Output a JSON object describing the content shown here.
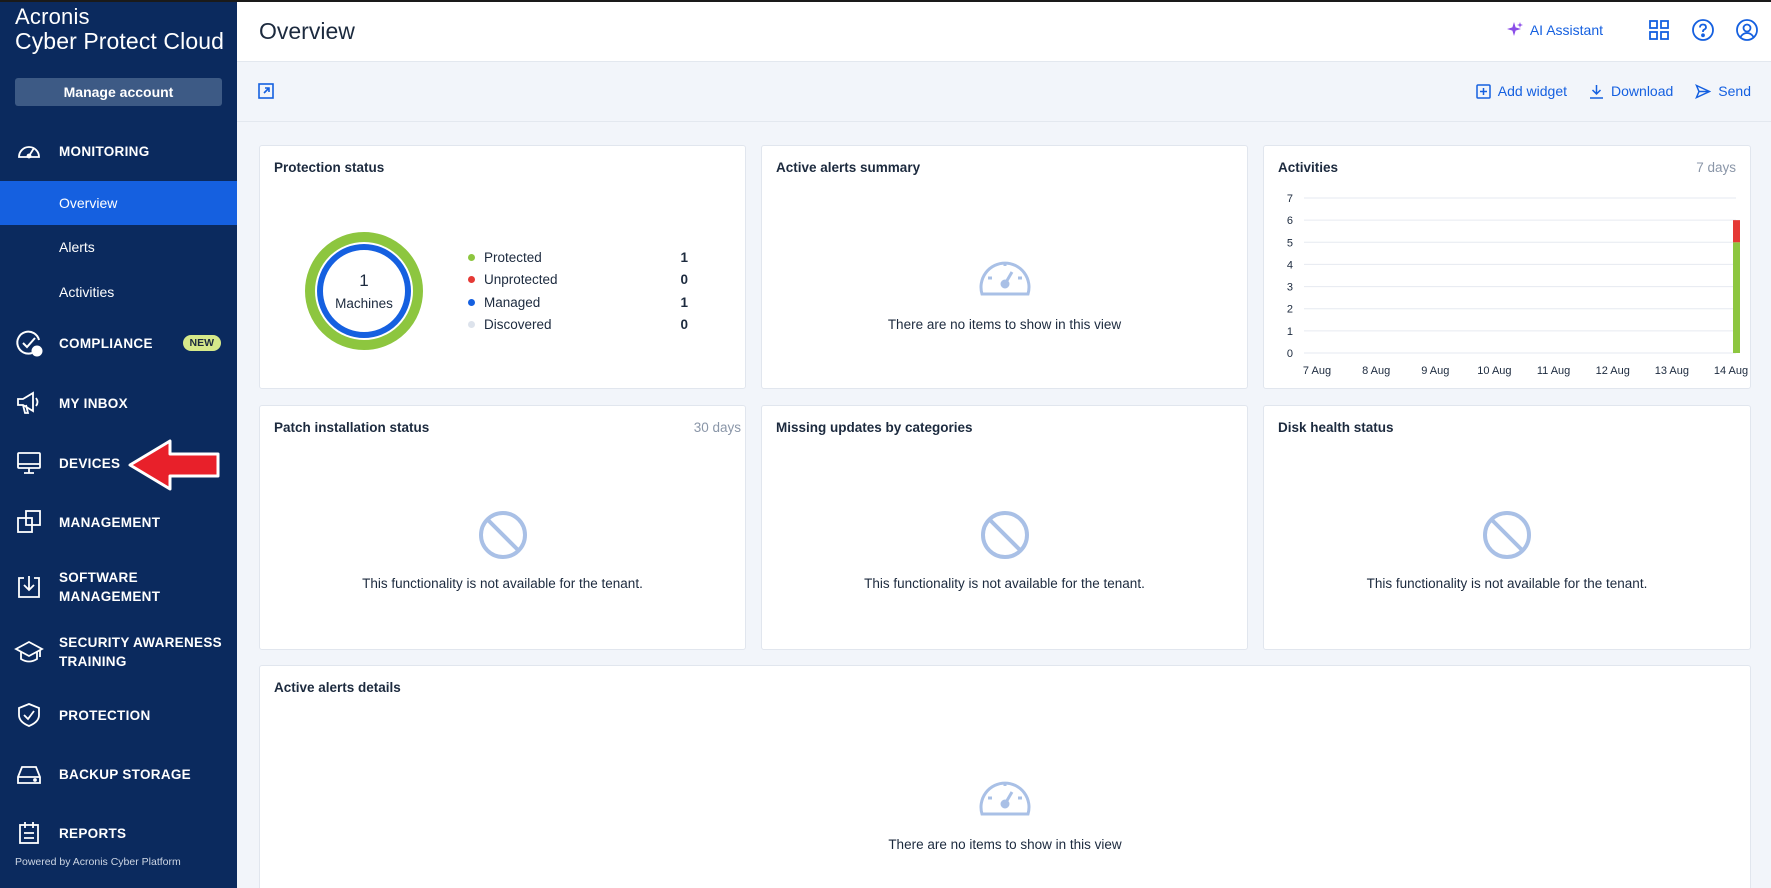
{
  "brand": {
    "line1": "Acronis",
    "line2": "Cyber Protect Cloud"
  },
  "sidebar": {
    "manage_account": "Manage account",
    "monitoring": "MONITORING",
    "sub_items": [
      "Overview",
      "Alerts",
      "Activities"
    ],
    "compliance": "COMPLIANCE",
    "new_badge": "NEW",
    "my_inbox": "MY INBOX",
    "devices": "DEVICES",
    "management": "MANAGEMENT",
    "software_management": [
      "SOFTWARE",
      "MANAGEMENT"
    ],
    "security_awareness": [
      "SECURITY AWARENESS",
      "TRAINING"
    ],
    "protection": "PROTECTION",
    "backup_storage": "BACKUP STORAGE",
    "reports": "REPORTS",
    "powered_by": "Powered by Acronis Cyber Platform"
  },
  "header": {
    "title": "Overview",
    "ai_assistant": "AI Assistant"
  },
  "toolbar": {
    "add_widget": "Add widget",
    "download": "Download",
    "send": "Send"
  },
  "widgets": {
    "protection_status": {
      "title": "Protection status",
      "center_value": "1",
      "center_label": "Machines",
      "legend": [
        {
          "name": "Protected",
          "value": "1",
          "color": "#8dc63f"
        },
        {
          "name": "Unprotected",
          "value": "0",
          "color": "#e53935"
        },
        {
          "name": "Managed",
          "value": "1",
          "color": "#1560e0"
        },
        {
          "name": "Discovered",
          "value": "0",
          "color": "#dde3ec"
        }
      ]
    },
    "active_alerts_summary": {
      "title": "Active alerts summary",
      "empty": "There are no items to show in this view"
    },
    "activities": {
      "title": "Activities",
      "range": "7 days"
    },
    "patch_installation": {
      "title": "Patch installation status",
      "range": "30 days",
      "empty": "This functionality is not available for the tenant."
    },
    "missing_updates": {
      "title": "Missing updates by categories",
      "empty": "This functionality is not available for the tenant."
    },
    "disk_health": {
      "title": "Disk health status",
      "empty": "This functionality is not available for the tenant."
    },
    "active_alerts_details": {
      "title": "Active alerts details",
      "empty": "There are no items to show in this view"
    }
  },
  "colors": {
    "accent": "#1560e0",
    "sidebar": "#0b2a5e",
    "success": "#8dc63f",
    "error": "#e53935"
  },
  "chart_data": {
    "type": "bar",
    "categories": [
      "7 Aug",
      "8 Aug",
      "9 Aug",
      "10 Aug",
      "11 Aug",
      "12 Aug",
      "13 Aug",
      "14 Aug"
    ],
    "series": [
      {
        "values": [
          0,
          0,
          0,
          0,
          0,
          0,
          0,
          5
        ],
        "color": "#8dc63f"
      },
      {
        "values": [
          0,
          0,
          0,
          0,
          0,
          0,
          0,
          1
        ],
        "color": "#e53935"
      }
    ],
    "stacked": true,
    "ylim": [
      0,
      7
    ],
    "yticks": [
      0,
      1,
      2,
      3,
      4,
      5,
      6,
      7
    ],
    "grid": true
  }
}
